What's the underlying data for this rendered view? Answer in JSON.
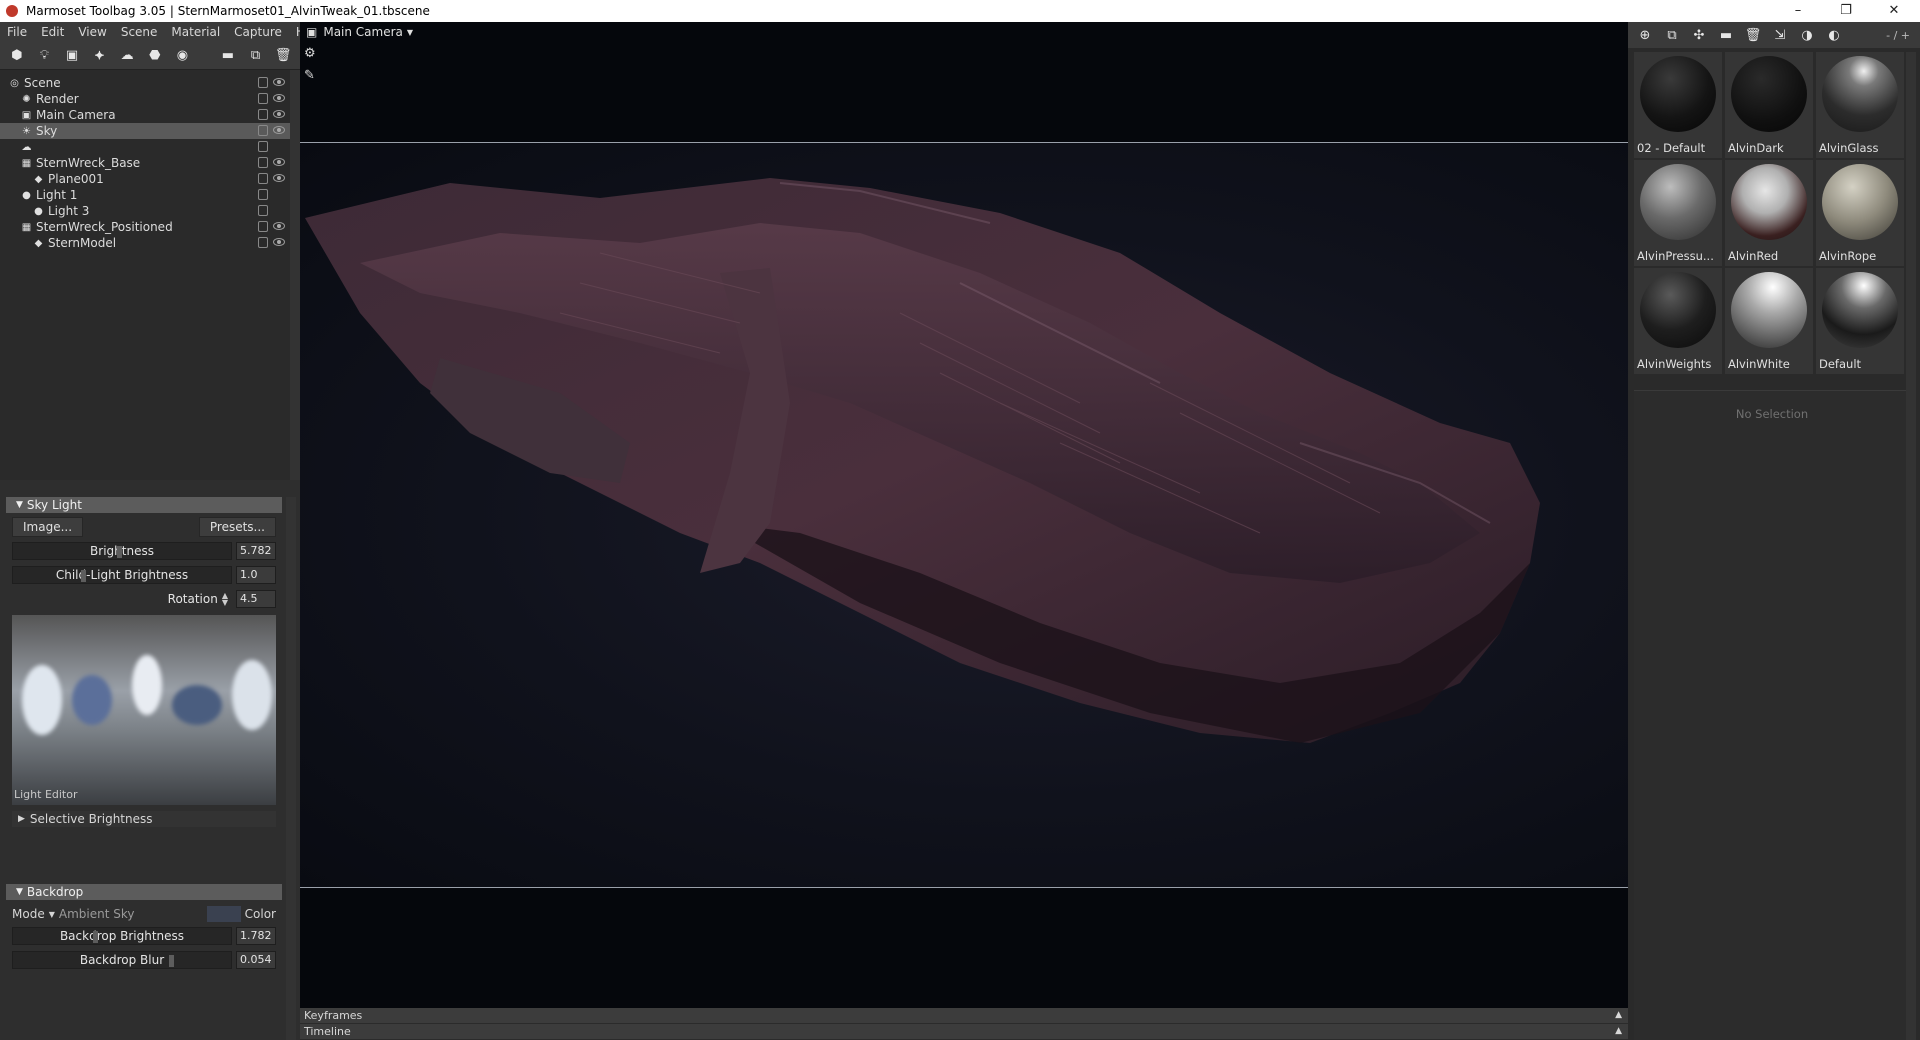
{
  "window": {
    "title": "Marmoset Toolbag 3.05  |  SternMarmoset01_AlvinTweak_01.tbscene",
    "controls": [
      "–",
      "❐",
      "✕"
    ]
  },
  "menu": [
    "File",
    "Edit",
    "View",
    "Scene",
    "Material",
    "Capture",
    "Help"
  ],
  "scene_toolbar_icons": [
    "object-icon",
    "light-icon",
    "camera-icon",
    "shadow-catcher-icon",
    "sky-icon",
    "turntable-icon",
    "fog-icon",
    "folder-icon",
    "duplicate-icon",
    "delete-icon"
  ],
  "tree": [
    {
      "label": "Scene",
      "icon": "◎",
      "indent": 0,
      "selected": false,
      "lock": true,
      "eye": true
    },
    {
      "label": "Render",
      "icon": "✺",
      "indent": 1,
      "selected": false,
      "lock": true,
      "eye": true
    },
    {
      "label": "Main Camera",
      "icon": "▣",
      "indent": 1,
      "selected": false,
      "lock": true,
      "eye": true
    },
    {
      "label": "Sky",
      "icon": "☀",
      "indent": 1,
      "selected": true,
      "lock": true,
      "eye": true
    },
    {
      "label": "",
      "icon": "☁",
      "indent": 1,
      "selected": false,
      "lock": true,
      "eye": false
    },
    {
      "label": "SternWreck_Base",
      "icon": "▦",
      "indent": 1,
      "selected": false,
      "lock": true,
      "eye": true
    },
    {
      "label": "Plane001",
      "icon": "◆",
      "indent": 2,
      "selected": false,
      "lock": true,
      "eye": true
    },
    {
      "label": "Light 1",
      "icon": "●",
      "indent": 1,
      "selected": false,
      "lock": true,
      "eye": false
    },
    {
      "label": "Light 3",
      "icon": "●",
      "indent": 2,
      "selected": false,
      "lock": true,
      "eye": false
    },
    {
      "label": "SternWreck_Positioned",
      "icon": "▦",
      "indent": 1,
      "selected": false,
      "lock": true,
      "eye": true
    },
    {
      "label": "SternModel",
      "icon": "◆",
      "indent": 2,
      "selected": false,
      "lock": true,
      "eye": true
    }
  ],
  "sky_light": {
    "header": "Sky Light",
    "image_btn": "Image...",
    "presets_btn": "Presets...",
    "brightness_label": "Brightness",
    "brightness_value": "5.782",
    "child_label": "Child-Light Brightness",
    "child_value": "1.0",
    "rotation_label": "Rotation",
    "rotation_value": "4.5",
    "light_editor": "Light Editor",
    "selective": "Selective Brightness"
  },
  "backdrop": {
    "header": "Backdrop",
    "mode_label": "Mode",
    "mode_value": "Ambient Sky",
    "color_label": "Color",
    "brightness_label": "Backdrop Brightness",
    "brightness_value": "1.782",
    "blur_label": "Backdrop Blur",
    "blur_value": "0.054"
  },
  "viewport": {
    "camera_label": "Main Camera"
  },
  "timeline": {
    "keyframes": "Keyframes",
    "timeline": "Timeline"
  },
  "materials": {
    "toolbar_icons": [
      "add-material-icon",
      "duplicate-material-icon",
      "pick-material-icon",
      "folder-icon",
      "delete-icon",
      "assign-icon",
      "check-icon",
      "settings-icon"
    ],
    "page": "- / +",
    "items": [
      {
        "name": "02 - Default",
        "style": "dark"
      },
      {
        "name": "AlvinDark",
        "style": "verydark"
      },
      {
        "name": "AlvinGlass",
        "style": "glass"
      },
      {
        "name": "AlvinPressu...",
        "style": "grey"
      },
      {
        "name": "AlvinRed",
        "style": "red"
      },
      {
        "name": "AlvinRope",
        "style": "beige"
      },
      {
        "name": "AlvinWeights",
        "style": "darkshiny"
      },
      {
        "name": "AlvinWhite",
        "style": "white"
      },
      {
        "name": "Default",
        "style": "chrome"
      }
    ],
    "no_selection": "No Selection"
  }
}
